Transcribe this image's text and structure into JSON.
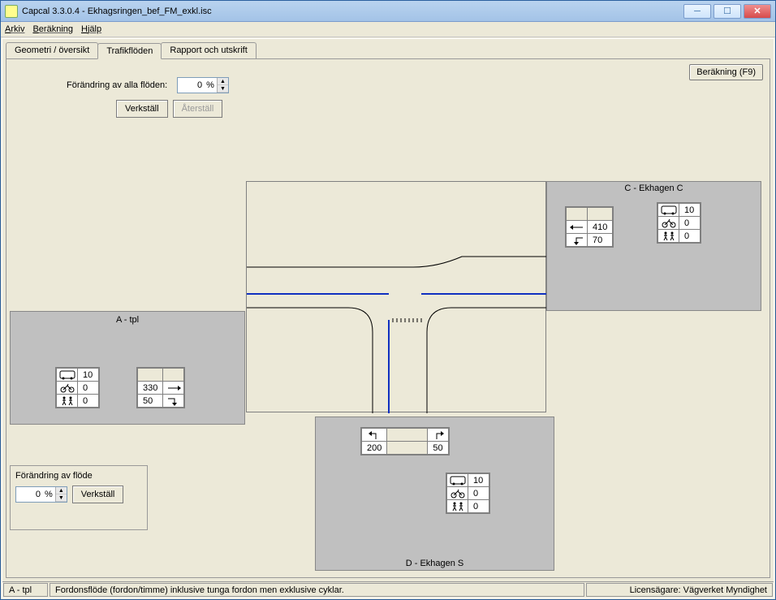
{
  "window": {
    "title": "Capcal 3.3.0.4 - Ekhagsringen_bef_FM_exkl.isc"
  },
  "menu": {
    "arkiv": "Arkiv",
    "berakning": "Beräkning",
    "hjalp": "Hjälp"
  },
  "tabs": {
    "geometri": "Geometri / översikt",
    "trafikfloden": "Trafikflöden",
    "rapport": "Rapport och utskrift"
  },
  "buttons": {
    "berakning": "Beräkning (F9)",
    "verkstall": "Verkställ",
    "aterstall": "Återställ"
  },
  "change_all": {
    "label": "Förändring av alla flöden:",
    "value": "0",
    "unit": "%"
  },
  "change_one": {
    "label": "Förändring av flöde",
    "value": "0",
    "unit": "%"
  },
  "panels": {
    "A": {
      "title": "A - tpl",
      "icons": [
        {
          "icon": "bus-icon",
          "value": "10"
        },
        {
          "icon": "bike-icon",
          "value": "0"
        },
        {
          "icon": "pedestrian-icon",
          "value": "0"
        }
      ],
      "flows": [
        {
          "icon": "arrow-right-icon",
          "value": "330"
        },
        {
          "icon": "arrow-right-down-icon",
          "value": "50"
        }
      ]
    },
    "C": {
      "title": "C - Ekhagen C",
      "icons": [
        {
          "icon": "bus-icon",
          "value": "10"
        },
        {
          "icon": "bike-icon",
          "value": "0"
        },
        {
          "icon": "pedestrian-icon",
          "value": "0"
        }
      ],
      "flows": [
        {
          "icon": "arrow-left-icon",
          "value": "410"
        },
        {
          "icon": "arrow-left-down-icon",
          "value": "70"
        }
      ]
    },
    "D": {
      "title": "D - Ekhagen S",
      "icons": [
        {
          "icon": "bus-icon",
          "value": "10"
        },
        {
          "icon": "bike-icon",
          "value": "0"
        },
        {
          "icon": "pedestrian-icon",
          "value": "0"
        }
      ],
      "flows": [
        {
          "icon": "arrow-up-left-icon",
          "value": "200"
        },
        {
          "icon": "arrow-up-right-icon",
          "value": "50"
        }
      ]
    }
  },
  "status": {
    "left": "A - tpl",
    "mid": "Fordonsflöde (fordon/timme) inklusive tunga fordon men exklusive cyklar.",
    "right": "Licensägare: Vägverket Myndighet"
  }
}
